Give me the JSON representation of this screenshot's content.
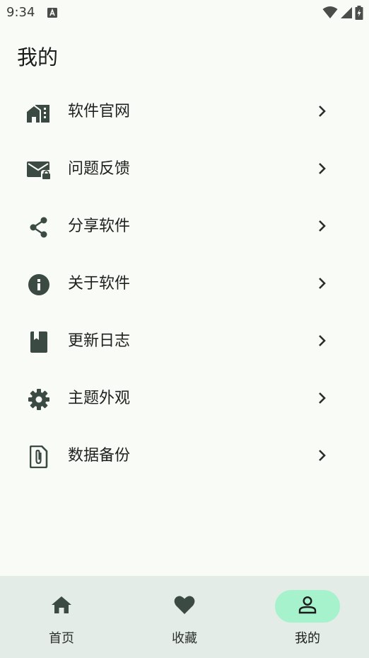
{
  "status_bar": {
    "time": "9:34",
    "icons": [
      "notification-a-icon",
      "wifi-icon",
      "cell-signal-icon",
      "battery-charging-icon"
    ]
  },
  "page": {
    "title": "我的"
  },
  "menu": {
    "items": [
      {
        "label": "软件官网",
        "icon": "building-icon"
      },
      {
        "label": "问题反馈",
        "icon": "mail-lock-icon"
      },
      {
        "label": "分享软件",
        "icon": "share-icon"
      },
      {
        "label": "关于软件",
        "icon": "info-icon"
      },
      {
        "label": "更新日志",
        "icon": "book-icon"
      },
      {
        "label": "主题外观",
        "icon": "gear-icon"
      },
      {
        "label": "数据备份",
        "icon": "file-attachment-icon"
      }
    ]
  },
  "bottom_nav": {
    "items": [
      {
        "label": "首页",
        "icon": "home-icon",
        "active": false
      },
      {
        "label": "收藏",
        "icon": "heart-icon",
        "active": false
      },
      {
        "label": "我的",
        "icon": "person-icon",
        "active": true
      }
    ]
  },
  "colors": {
    "background": "#f9fbf7",
    "icon": "#3b4a42",
    "nav_background": "#e3ece6",
    "nav_active_pill": "#a6f2cd"
  }
}
